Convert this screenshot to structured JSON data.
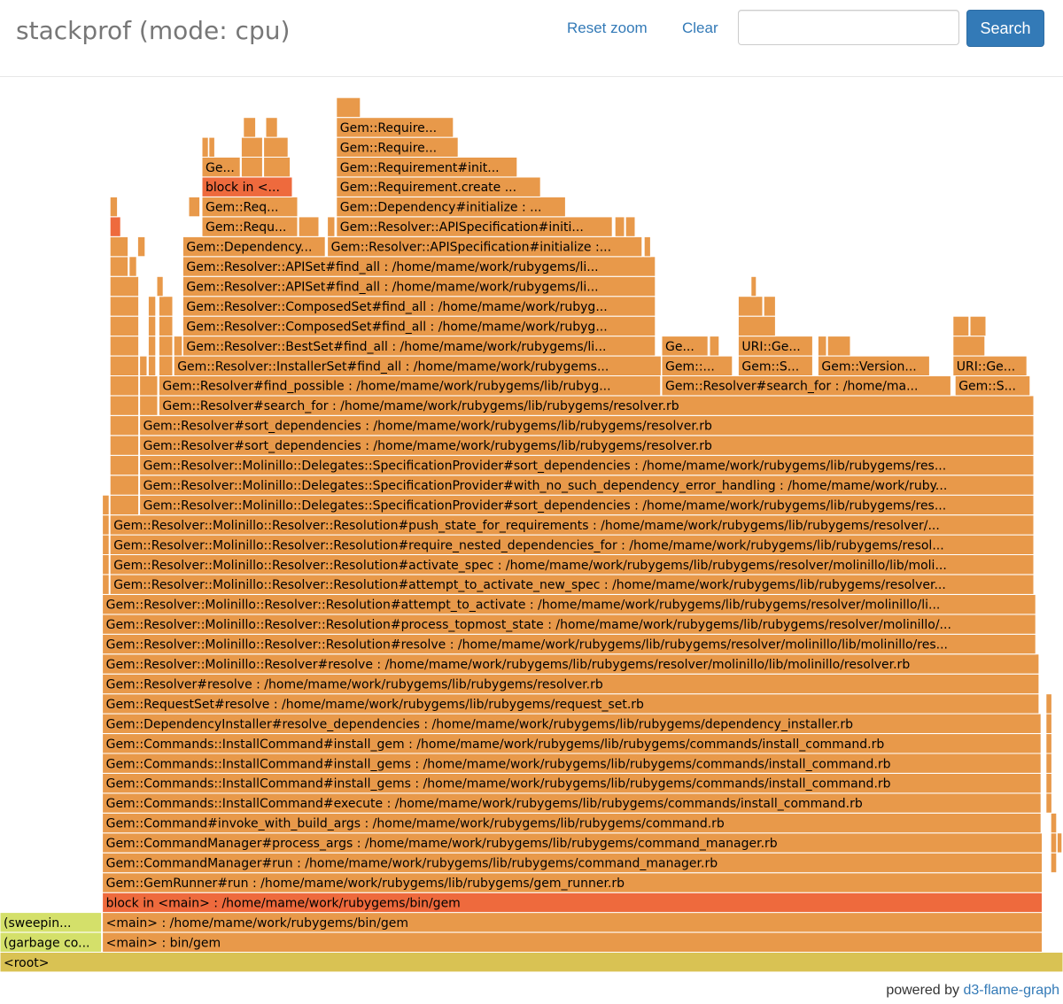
{
  "header": {
    "title": "stackprof (mode: cpu)",
    "reset_zoom_label": "Reset zoom",
    "clear_label": "Clear",
    "search_value": "",
    "search_label": "Search"
  },
  "footer": {
    "prefix": "powered by",
    "link_label": "d3-flame-graph"
  },
  "colors": {
    "frame": "#E8994A",
    "hot": "#EE6A3D",
    "root": "#D9C253",
    "gc": "#D4E06A"
  },
  "frames": [
    {
      "label": "<root>",
      "depth": 0,
      "start": 0.0,
      "width": 1.0,
      "color": "root"
    },
    {
      "label": "(garbage co...",
      "depth": 1,
      "start": 0.0,
      "width": 0.0955,
      "color": "gc"
    },
    {
      "label": "(sweepin...",
      "depth": 2,
      "start": 0.0,
      "width": 0.0955,
      "color": "gc"
    },
    {
      "label": "<main> : bin/gem",
      "depth": 1,
      "start": 0.0963,
      "width": 0.8841,
      "color": "frame"
    },
    {
      "label": "<main> : /home/mame/work/rubygems/bin/gem",
      "depth": 2,
      "start": 0.0963,
      "width": 0.8841,
      "color": "frame"
    },
    {
      "label": "block in <main> : /home/mame/work/rubygems/bin/gem",
      "depth": 3,
      "start": 0.0963,
      "width": 0.8841,
      "color": "hot"
    },
    {
      "label": "Gem::GemRunner#run : /home/mame/work/rubygems/lib/rubygems/gem_runner.rb",
      "depth": 4,
      "start": 0.0963,
      "width": 0.8841,
      "color": "frame"
    },
    {
      "label": "Gem::CommandManager#run : /home/mame/work/rubygems/lib/rubygems/command_manager.rb",
      "depth": 5,
      "start": 0.0963,
      "width": 0.8841,
      "color": "frame"
    },
    {
      "label": "Gem::CommandManager#process_args : /home/mame/work/rubygems/lib/rubygems/command_manager.rb",
      "depth": 6,
      "start": 0.0963,
      "width": 0.8841,
      "color": "frame"
    },
    {
      "label": "",
      "depth": 5,
      "start": 0.9885,
      "width": 0.0055,
      "color": "frame"
    },
    {
      "label": "",
      "depth": 6,
      "start": 0.9885,
      "width": 0.0055,
      "color": "frame"
    },
    {
      "label": "",
      "depth": 7,
      "start": 0.9885,
      "width": 0.0055,
      "color": "frame"
    },
    {
      "label": "",
      "depth": 6,
      "start": 0.9945,
      "width": 0.0045,
      "color": "frame"
    },
    {
      "label": "",
      "depth": 8,
      "start": 0.984,
      "width": 0.0055,
      "color": "frame"
    },
    {
      "label": "",
      "depth": 9,
      "start": 0.984,
      "width": 0.0055,
      "color": "frame"
    },
    {
      "label": "",
      "depth": 10,
      "start": 0.984,
      "width": 0.0055,
      "color": "frame"
    },
    {
      "label": "",
      "depth": 11,
      "start": 0.984,
      "width": 0.0055,
      "color": "frame"
    },
    {
      "label": "",
      "depth": 12,
      "start": 0.984,
      "width": 0.0055,
      "color": "frame"
    },
    {
      "label": "",
      "depth": 13,
      "start": 0.984,
      "width": 0.0055,
      "color": "frame"
    },
    {
      "label": "Gem::Command#invoke_with_build_args : /home/mame/work/rubygems/lib/rubygems/command.rb",
      "depth": 7,
      "start": 0.0963,
      "width": 0.883,
      "color": "frame"
    },
    {
      "label": "Gem::Commands::InstallCommand#execute : /home/mame/work/rubygems/lib/rubygems/commands/install_command.rb",
      "depth": 8,
      "start": 0.0963,
      "width": 0.883,
      "color": "frame"
    },
    {
      "label": "Gem::Commands::InstallCommand#install_gems : /home/mame/work/rubygems/lib/rubygems/commands/install_command.rb",
      "depth": 9,
      "start": 0.0963,
      "width": 0.883,
      "color": "frame"
    },
    {
      "label": "Gem::Commands::InstallCommand#install_gems : /home/mame/work/rubygems/lib/rubygems/commands/install_command.rb",
      "depth": 10,
      "start": 0.0963,
      "width": 0.883,
      "color": "frame"
    },
    {
      "label": "Gem::Commands::InstallCommand#install_gem : /home/mame/work/rubygems/lib/rubygems/commands/install_command.rb",
      "depth": 11,
      "start": 0.0963,
      "width": 0.883,
      "color": "frame"
    },
    {
      "label": "Gem::DependencyInstaller#resolve_dependencies : /home/mame/work/rubygems/lib/rubygems/dependency_installer.rb",
      "depth": 12,
      "start": 0.0963,
      "width": 0.883,
      "color": "frame"
    },
    {
      "label": "Gem::RequestSet#resolve : /home/mame/work/rubygems/lib/rubygems/request_set.rb",
      "depth": 13,
      "start": 0.0963,
      "width": 0.8811,
      "color": "frame"
    },
    {
      "label": "Gem::Resolver#resolve : /home/mame/work/rubygems/lib/rubygems/resolver.rb",
      "depth": 14,
      "start": 0.0963,
      "width": 0.8811,
      "color": "frame"
    },
    {
      "label": "Gem::Resolver::Molinillo::Resolver#resolve : /home/mame/work/rubygems/lib/rubygems/resolver/molinillo/lib/molinillo/resolver.rb",
      "depth": 15,
      "start": 0.0963,
      "width": 0.8811,
      "color": "frame"
    },
    {
      "label": "Gem::Resolver::Molinillo::Resolver::Resolution#resolve : /home/mame/work/rubygems/lib/rubygems/resolver/molinillo/lib/molinillo/res...",
      "depth": 16,
      "start": 0.0963,
      "width": 0.878,
      "color": "frame"
    },
    {
      "label": "Gem::Resolver::Molinillo::Resolver::Resolution#process_topmost_state : /home/mame/work/rubygems/lib/rubygems/resolver/molinillo/...",
      "depth": 17,
      "start": 0.0963,
      "width": 0.878,
      "color": "frame"
    },
    {
      "label": "Gem::Resolver::Molinillo::Resolver::Resolution#attempt_to_activate : /home/mame/work/rubygems/lib/rubygems/resolver/molinillo/li...",
      "depth": 18,
      "start": 0.0963,
      "width": 0.878,
      "color": "frame"
    },
    {
      "label": "",
      "depth": 19,
      "start": 0.0963,
      "width": 0.0063,
      "color": "frame"
    },
    {
      "label": "Gem::Resolver::Molinillo::Resolver::Resolution#attempt_to_activate_new_spec : /home/mame/work/rubygems/lib/rubygems/resolver...",
      "depth": 19,
      "start": 0.1035,
      "width": 0.869,
      "color": "frame"
    },
    {
      "label": "Gem::Resolver::Molinillo::Resolver::Resolution#activate_spec : /home/mame/work/rubygems/lib/rubygems/resolver/molinillo/lib/moli...",
      "depth": 20,
      "start": 0.1035,
      "width": 0.869,
      "color": "frame"
    },
    {
      "label": "Gem::Resolver::Molinillo::Resolver::Resolution#require_nested_dependencies_for : /home/mame/work/rubygems/lib/rubygems/resol...",
      "depth": 21,
      "start": 0.1035,
      "width": 0.869,
      "color": "frame"
    },
    {
      "label": "Gem::Resolver::Molinillo::Resolver::Resolution#push_state_for_requirements : /home/mame/work/rubygems/lib/rubygems/resolver/...",
      "depth": 22,
      "start": 0.1035,
      "width": 0.869,
      "color": "frame"
    },
    {
      "label": "",
      "depth": 20,
      "start": 0.0963,
      "width": 0.0063,
      "color": "frame"
    },
    {
      "label": "",
      "depth": 21,
      "start": 0.0963,
      "width": 0.0063,
      "color": "frame"
    },
    {
      "label": "",
      "depth": 22,
      "start": 0.0963,
      "width": 0.0063,
      "color": "frame"
    },
    {
      "label": "",
      "depth": 23,
      "start": 0.0963,
      "width": 0.0063,
      "color": "frame"
    },
    {
      "label": "",
      "depth": 23,
      "start": 0.1035,
      "width": 0.027,
      "color": "frame"
    },
    {
      "label": "Gem::Resolver::Molinillo::Delegates::SpecificationProvider#sort_dependencies : /home/mame/work/rubygems/lib/rubygems/res...",
      "depth": 23,
      "start": 0.1313,
      "width": 0.8412,
      "color": "frame"
    },
    {
      "label": "",
      "depth": 24,
      "start": 0.1035,
      "width": 0.027,
      "color": "frame"
    },
    {
      "label": "Gem::Resolver::Molinillo::Delegates::SpecificationProvider#with_no_such_dependency_error_handling : /home/mame/work/ruby...",
      "depth": 24,
      "start": 0.1313,
      "width": 0.8412,
      "color": "frame"
    },
    {
      "label": "",
      "depth": 25,
      "start": 0.1035,
      "width": 0.027,
      "color": "frame"
    },
    {
      "label": "Gem::Resolver::Molinillo::Delegates::SpecificationProvider#sort_dependencies : /home/mame/work/rubygems/lib/rubygems/res...",
      "depth": 25,
      "start": 0.1313,
      "width": 0.8412,
      "color": "frame"
    },
    {
      "label": "",
      "depth": 26,
      "start": 0.1035,
      "width": 0.027,
      "color": "frame"
    },
    {
      "label": "Gem::Resolver#sort_dependencies : /home/mame/work/rubygems/lib/rubygems/resolver.rb",
      "depth": 26,
      "start": 0.1313,
      "width": 0.8412,
      "color": "frame"
    },
    {
      "label": "",
      "depth": 27,
      "start": 0.1035,
      "width": 0.027,
      "color": "frame"
    },
    {
      "label": "Gem::Resolver#sort_dependencies : /home/mame/work/rubygems/lib/rubygems/resolver.rb",
      "depth": 27,
      "start": 0.1313,
      "width": 0.8412,
      "color": "frame"
    },
    {
      "label": "",
      "depth": 28,
      "start": 0.1035,
      "width": 0.027,
      "color": "frame"
    },
    {
      "label": "Gem::Resolver#search_for : /home/mame/work/rubygems/lib/rubygems/resolver.rb",
      "depth": 28,
      "start": 0.1495,
      "width": 0.823,
      "color": "frame"
    },
    {
      "label": "",
      "depth": 28,
      "start": 0.1313,
      "width": 0.017,
      "color": "frame"
    },
    {
      "label": "",
      "depth": 29,
      "start": 0.1035,
      "width": 0.027,
      "color": "frame"
    },
    {
      "label": "",
      "depth": 29,
      "start": 0.1313,
      "width": 0.017,
      "color": "frame"
    },
    {
      "label": "Gem::Resolver#find_possible : /home/mame/work/rubygems/lib/rubyg...",
      "depth": 29,
      "start": 0.1495,
      "width": 0.472,
      "color": "frame"
    },
    {
      "label": "Gem::Resolver#search_for : /home/ma...",
      "depth": 29,
      "start": 0.6225,
      "width": 0.272,
      "color": "frame"
    },
    {
      "label": "Gem::S...",
      "depth": 29,
      "start": 0.8985,
      "width": 0.0705,
      "color": "frame"
    },
    {
      "label": "",
      "depth": 30,
      "start": 0.1035,
      "width": 0.027,
      "color": "frame"
    },
    {
      "label": "",
      "depth": 30,
      "start": 0.1313,
      "width": 0.007,
      "color": "frame"
    },
    {
      "label": "",
      "depth": 30,
      "start": 0.1395,
      "width": 0.007,
      "color": "frame"
    },
    {
      "label": "",
      "depth": 30,
      "start": 0.1495,
      "width": 0.013,
      "color": "frame"
    },
    {
      "label": "Gem::Resolver::InstallerSet#find_all : /home/mame/work/rubygems...",
      "depth": 30,
      "start": 0.1635,
      "width": 0.4585,
      "color": "frame"
    },
    {
      "label": "Gem::...",
      "depth": 30,
      "start": 0.6225,
      "width": 0.0665,
      "color": "frame"
    },
    {
      "label": "Gem::S...",
      "depth": 30,
      "start": 0.6945,
      "width": 0.07,
      "color": "frame"
    },
    {
      "label": "Gem::Version...",
      "depth": 30,
      "start": 0.7695,
      "width": 0.105,
      "color": "frame"
    },
    {
      "label": "URI::Ge...",
      "depth": 30,
      "start": 0.8965,
      "width": 0.0695,
      "color": "frame"
    },
    {
      "label": "",
      "depth": 31,
      "start": 0.1035,
      "width": 0.027,
      "color": "frame"
    },
    {
      "label": "",
      "depth": 31,
      "start": 0.1395,
      "width": 0.007,
      "color": "frame"
    },
    {
      "label": "",
      "depth": 31,
      "start": 0.1495,
      "width": 0.013,
      "color": "frame"
    },
    {
      "label": "",
      "depth": 31,
      "start": 0.1635,
      "width": 0.008,
      "color": "frame"
    },
    {
      "label": "Gem::Resolver::BestSet#find_all : /home/mame/work/rubygems/li...",
      "depth": 31,
      "start": 0.172,
      "width": 0.4445,
      "color": "frame"
    },
    {
      "label": "Ge...",
      "depth": 31,
      "start": 0.6225,
      "width": 0.0435,
      "color": "frame"
    },
    {
      "label": "",
      "depth": 31,
      "start": 0.6675,
      "width": 0.009,
      "color": "frame"
    },
    {
      "label": "URI::Ge...",
      "depth": 31,
      "start": 0.6945,
      "width": 0.07,
      "color": "frame"
    },
    {
      "label": "",
      "depth": 31,
      "start": 0.7695,
      "width": 0.008,
      "color": "frame"
    },
    {
      "label": "",
      "depth": 31,
      "start": 0.7785,
      "width": 0.0215,
      "color": "frame"
    },
    {
      "label": "",
      "depth": 31,
      "start": 0.8965,
      "width": 0.03,
      "color": "frame"
    },
    {
      "label": "",
      "depth": 32,
      "start": 0.1035,
      "width": 0.027,
      "color": "frame"
    },
    {
      "label": "",
      "depth": 32,
      "start": 0.1395,
      "width": 0.007,
      "color": "frame"
    },
    {
      "label": "",
      "depth": 32,
      "start": 0.1495,
      "width": 0.013,
      "color": "frame"
    },
    {
      "label": "Gem::Resolver::ComposedSet#find_all : /home/mame/work/rubyg...",
      "depth": 32,
      "start": 0.172,
      "width": 0.4445,
      "color": "frame"
    },
    {
      "label": "",
      "depth": 32,
      "start": 0.6945,
      "width": 0.035,
      "color": "frame"
    },
    {
      "label": "",
      "depth": 32,
      "start": 0.8965,
      "width": 0.015,
      "color": "frame"
    },
    {
      "label": "",
      "depth": 32,
      "start": 0.9125,
      "width": 0.015,
      "color": "frame"
    },
    {
      "label": "",
      "depth": 33,
      "start": 0.1035,
      "width": 0.027,
      "color": "frame"
    },
    {
      "label": "",
      "depth": 33,
      "start": 0.1395,
      "width": 0.007,
      "color": "frame"
    },
    {
      "label": "",
      "depth": 33,
      "start": 0.1495,
      "width": 0.013,
      "color": "frame"
    },
    {
      "label": "Gem::Resolver::ComposedSet#find_all : /home/mame/work/rubyg...",
      "depth": 33,
      "start": 0.172,
      "width": 0.4445,
      "color": "frame"
    },
    {
      "label": "",
      "depth": 33,
      "start": 0.6945,
      "width": 0.023,
      "color": "frame"
    },
    {
      "label": "",
      "depth": 33,
      "start": 0.7185,
      "width": 0.011,
      "color": "frame"
    },
    {
      "label": "",
      "depth": 34,
      "start": 0.1035,
      "width": 0.027,
      "color": "frame"
    },
    {
      "label": "",
      "depth": 34,
      "start": 0.1475,
      "width": 0.006,
      "color": "frame"
    },
    {
      "label": "Gem::Resolver::APISet#find_all : /home/mame/work/rubygems/li...",
      "depth": 34,
      "start": 0.172,
      "width": 0.4445,
      "color": "frame"
    },
    {
      "label": "",
      "depth": 34,
      "start": 0.7065,
      "width": 0.005,
      "color": "frame"
    },
    {
      "label": "",
      "depth": 35,
      "start": 0.1035,
      "width": 0.017,
      "color": "frame"
    },
    {
      "label": "",
      "depth": 35,
      "start": 0.1215,
      "width": 0.007,
      "color": "frame"
    },
    {
      "label": "Gem::Resolver::APISet#find_all : /home/mame/work/rubygems/li...",
      "depth": 35,
      "start": 0.172,
      "width": 0.4445,
      "color": "frame"
    },
    {
      "label": "",
      "depth": 36,
      "start": 0.1035,
      "width": 0.017,
      "color": "frame"
    },
    {
      "label": "",
      "depth": 36,
      "start": 0.1295,
      "width": 0.007,
      "color": "frame"
    },
    {
      "label": "Gem::Dependency...",
      "depth": 36,
      "start": 0.172,
      "width": 0.134,
      "color": "frame"
    },
    {
      "label": "Gem::Resolver::APISpecification#initialize :...",
      "depth": 36,
      "start": 0.308,
      "width": 0.296,
      "color": "frame"
    },
    {
      "label": "",
      "depth": 36,
      "start": 0.606,
      "width": 0.006,
      "color": "frame"
    },
    {
      "label": "",
      "depth": 37,
      "start": 0.1035,
      "width": 0.01,
      "color": "hot"
    },
    {
      "label": "Gem::Requ...",
      "depth": 37,
      "start": 0.19,
      "width": 0.09,
      "color": "frame"
    },
    {
      "label": "",
      "depth": 37,
      "start": 0.281,
      "width": 0.019,
      "color": "frame"
    },
    {
      "label": "",
      "depth": 37,
      "start": 0.308,
      "width": 0.007,
      "color": "frame"
    },
    {
      "label": "Gem::Resolver::APISpecification#initi...",
      "depth": 37,
      "start": 0.3165,
      "width": 0.2595,
      "color": "frame"
    },
    {
      "label": "",
      "depth": 37,
      "start": 0.5785,
      "width": 0.009,
      "color": "frame"
    },
    {
      "label": "",
      "depth": 37,
      "start": 0.5885,
      "width": 0.009,
      "color": "frame"
    },
    {
      "label": "",
      "depth": 38,
      "start": 0.1035,
      "width": 0.007,
      "color": "frame"
    },
    {
      "label": "",
      "depth": 38,
      "start": 0.1775,
      "width": 0.0105,
      "color": "frame"
    },
    {
      "label": "Gem::Req...",
      "depth": 38,
      "start": 0.19,
      "width": 0.09,
      "color": "frame"
    },
    {
      "label": "Gem::Dependency#initialize : ...",
      "depth": 38,
      "start": 0.3165,
      "width": 0.2155,
      "color": "frame"
    },
    {
      "label": "block in <...",
      "depth": 39,
      "start": 0.19,
      "width": 0.085,
      "color": "hot"
    },
    {
      "label": "Gem::Requirement.create ...",
      "depth": 39,
      "start": 0.3165,
      "width": 0.192,
      "color": "frame"
    },
    {
      "label": "Ge...",
      "depth": 40,
      "start": 0.19,
      "width": 0.036,
      "color": "frame"
    },
    {
      "label": "",
      "depth": 40,
      "start": 0.227,
      "width": 0.02,
      "color": "frame"
    },
    {
      "label": "",
      "depth": 40,
      "start": 0.248,
      "width": 0.025,
      "color": "frame"
    },
    {
      "label": "Gem::Requirement#init...",
      "depth": 40,
      "start": 0.3165,
      "width": 0.17,
      "color": "frame"
    },
    {
      "label": "",
      "depth": 41,
      "start": 0.19,
      "width": 0.006,
      "color": "frame"
    },
    {
      "label": "",
      "depth": 41,
      "start": 0.1965,
      "width": 0.0055,
      "color": "frame"
    },
    {
      "label": "",
      "depth": 41,
      "start": 0.227,
      "width": 0.02,
      "color": "frame"
    },
    {
      "label": "",
      "depth": 41,
      "start": 0.248,
      "width": 0.023,
      "color": "frame"
    },
    {
      "label": "Gem::Require...",
      "depth": 41,
      "start": 0.3165,
      "width": 0.1145,
      "color": "frame"
    },
    {
      "label": "",
      "depth": 42,
      "start": 0.229,
      "width": 0.0115,
      "color": "frame"
    },
    {
      "label": "",
      "depth": 42,
      "start": 0.25,
      "width": 0.011,
      "color": "frame"
    },
    {
      "label": "Gem::Require...",
      "depth": 42,
      "start": 0.3165,
      "width": 0.11,
      "color": "frame"
    },
    {
      "label": "",
      "depth": 43,
      "start": 0.3165,
      "width": 0.0225,
      "color": "frame"
    }
  ]
}
